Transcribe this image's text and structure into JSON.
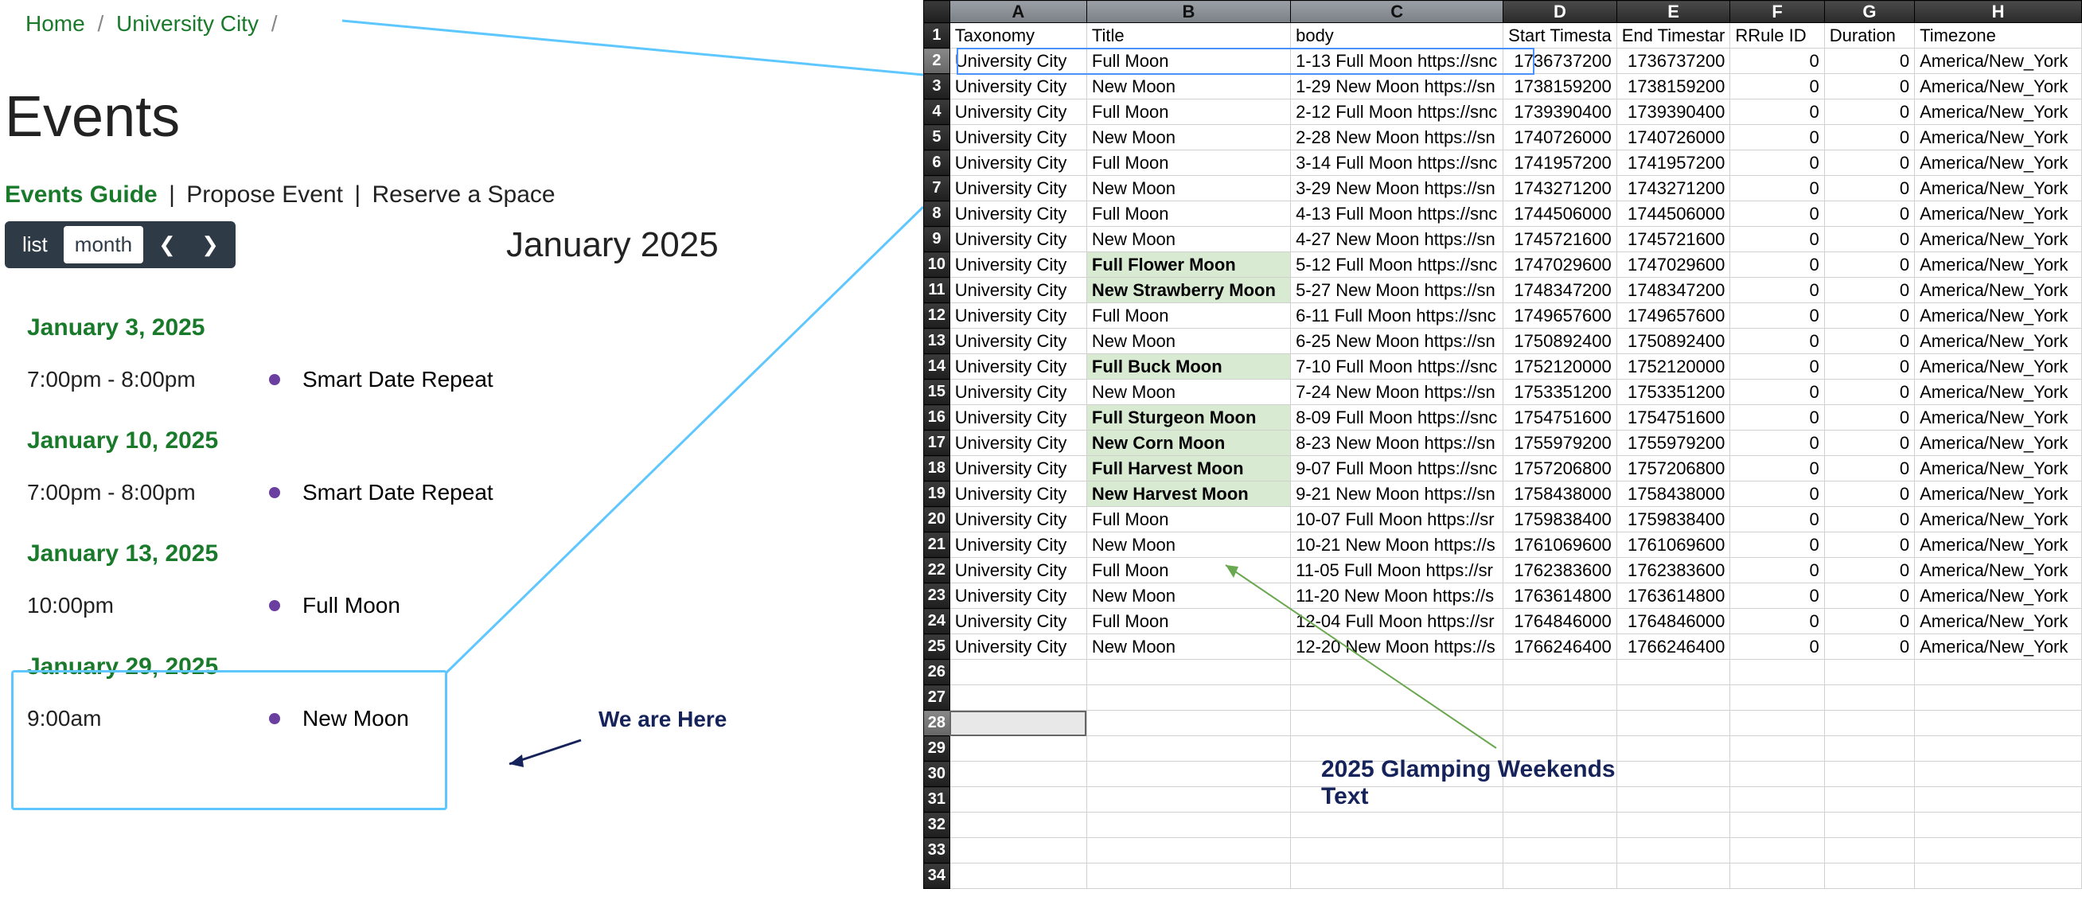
{
  "breadcrumb": {
    "home": "Home",
    "city": "University City"
  },
  "page_title": "Events",
  "subnav": {
    "guide": "Events Guide",
    "propose": "Propose Event",
    "reserve": "Reserve a Space"
  },
  "view": {
    "list": "list",
    "month": "month"
  },
  "month_label": "January 2025",
  "groups": [
    {
      "date": "January 3, 2025",
      "events": [
        {
          "time": "7:00pm - 8:00pm",
          "title": "Smart Date Repeat"
        }
      ]
    },
    {
      "date": "January 10, 2025",
      "events": [
        {
          "time": "7:00pm - 8:00pm",
          "title": "Smart Date Repeat"
        }
      ]
    },
    {
      "date": "January 13, 2025",
      "events": [
        {
          "time": "10:00pm",
          "title": "Full Moon"
        }
      ]
    },
    {
      "date": "January 29, 2025",
      "events": [
        {
          "time": "9:00am",
          "title": "New Moon"
        }
      ]
    }
  ],
  "callout": "We are Here",
  "sheet_annot": "2025 Glamping Weekends\nText",
  "columns": [
    "A",
    "B",
    "C",
    "D",
    "E",
    "F",
    "G",
    "H"
  ],
  "headers": [
    "Taxonomy",
    "Title",
    "body",
    "Start Timesta",
    "End Timestar",
    "RRule ID",
    "Duration",
    "Timezone"
  ],
  "rows": [
    {
      "a": "University City",
      "b": "Full Moon",
      "c": "1-13 Full Moon https://snc",
      "d": "1736737200",
      "e": "1736737200",
      "f": "0",
      "g": "0",
      "h": "America/New_York"
    },
    {
      "a": "University City",
      "b": "New Moon",
      "c": "1-29 New Moon https://sn",
      "d": "1738159200",
      "e": "1738159200",
      "f": "0",
      "g": "0",
      "h": "America/New_York"
    },
    {
      "a": "University City",
      "b": "Full Moon",
      "c": "2-12 Full Moon https://snc",
      "d": "1739390400",
      "e": "1739390400",
      "f": "0",
      "g": "0",
      "h": "America/New_York"
    },
    {
      "a": "University City",
      "b": "New Moon",
      "c": "2-28 New Moon https://sn",
      "d": "1740726000",
      "e": "1740726000",
      "f": "0",
      "g": "0",
      "h": "America/New_York"
    },
    {
      "a": "University City",
      "b": "Full Moon",
      "c": "3-14 Full Moon https://snc",
      "d": "1741957200",
      "e": "1741957200",
      "f": "0",
      "g": "0",
      "h": "America/New_York"
    },
    {
      "a": "University City",
      "b": "New Moon",
      "c": "3-29 New Moon https://sn",
      "d": "1743271200",
      "e": "1743271200",
      "f": "0",
      "g": "0",
      "h": "America/New_York"
    },
    {
      "a": "University City",
      "b": "Full Moon",
      "c": "4-13 Full Moon https://snc",
      "d": "1744506000",
      "e": "1744506000",
      "f": "0",
      "g": "0",
      "h": "America/New_York"
    },
    {
      "a": "University City",
      "b": "New Moon",
      "c": "4-27 New Moon https://sn",
      "d": "1745721600",
      "e": "1745721600",
      "f": "0",
      "g": "0",
      "h": "America/New_York"
    },
    {
      "a": "University City",
      "b": "Full Flower Moon",
      "bold": true,
      "hl": true,
      "c": "5-12 Full Moon https://snc",
      "d": "1747029600",
      "e": "1747029600",
      "f": "0",
      "g": "0",
      "h": "America/New_York"
    },
    {
      "a": "University City",
      "b": "New Strawberry Moon",
      "bold": true,
      "hl": true,
      "c": "5-27 New Moon https://sn",
      "d": "1748347200",
      "e": "1748347200",
      "f": "0",
      "g": "0",
      "h": "America/New_York"
    },
    {
      "a": "University City",
      "b": "Full Moon",
      "c": "6-11 Full Moon https://snc",
      "d": "1749657600",
      "e": "1749657600",
      "f": "0",
      "g": "0",
      "h": "America/New_York"
    },
    {
      "a": "University City",
      "b": "New Moon",
      "c": "6-25 New Moon https://sn",
      "d": "1750892400",
      "e": "1750892400",
      "f": "0",
      "g": "0",
      "h": "America/New_York"
    },
    {
      "a": "University City",
      "b": "Full Buck Moon",
      "bold": true,
      "hl": true,
      "c": "7-10 Full Moon https://snc",
      "d": "1752120000",
      "e": "1752120000",
      "f": "0",
      "g": "0",
      "h": "America/New_York"
    },
    {
      "a": "University City",
      "b": "New Moon",
      "c": "7-24 New Moon https://sn",
      "d": "1753351200",
      "e": "1753351200",
      "f": "0",
      "g": "0",
      "h": "America/New_York"
    },
    {
      "a": "University City",
      "b": "Full Sturgeon Moon",
      "bold": true,
      "hl": true,
      "c": "8-09 Full Moon https://snc",
      "d": "1754751600",
      "e": "1754751600",
      "f": "0",
      "g": "0",
      "h": "America/New_York"
    },
    {
      "a": "University City",
      "b": "New Corn Moon",
      "bold": true,
      "hl": true,
      "c": "8-23 New Moon https://sn",
      "d": "1755979200",
      "e": "1755979200",
      "f": "0",
      "g": "0",
      "h": "America/New_York"
    },
    {
      "a": "University City",
      "b": "Full Harvest Moon",
      "bold": true,
      "hl": true,
      "c": "9-07 Full Moon https://snc",
      "d": "1757206800",
      "e": "1757206800",
      "f": "0",
      "g": "0",
      "h": "America/New_York"
    },
    {
      "a": "University City",
      "b": "New Harvest Moon",
      "bold": true,
      "hl": true,
      "c": "9-21 New Moon https://sn",
      "d": "1758438000",
      "e": "1758438000",
      "f": "0",
      "g": "0",
      "h": "America/New_York"
    },
    {
      "a": "University City",
      "b": "Full Moon",
      "c": "10-07 Full Moon https://sr",
      "d": "1759838400",
      "e": "1759838400",
      "f": "0",
      "g": "0",
      "h": "America/New_York"
    },
    {
      "a": "University City",
      "b": "New Moon",
      "c": "10-21 New Moon https://s",
      "d": "1761069600",
      "e": "1761069600",
      "f": "0",
      "g": "0",
      "h": "America/New_York"
    },
    {
      "a": "University City",
      "b": "Full Moon",
      "c": "11-05 Full Moon https://sr",
      "d": "1762383600",
      "e": "1762383600",
      "f": "0",
      "g": "0",
      "h": "America/New_York"
    },
    {
      "a": "University City",
      "b": "New Moon",
      "c": "11-20 New Moon https://s",
      "d": "1763614800",
      "e": "1763614800",
      "f": "0",
      "g": "0",
      "h": "America/New_York"
    },
    {
      "a": "University City",
      "b": "Full Moon",
      "c": "12-04 Full Moon https://sr",
      "d": "1764846000",
      "e": "1764846000",
      "f": "0",
      "g": "0",
      "h": "America/New_York"
    },
    {
      "a": "University City",
      "b": "New Moon",
      "c": "12-20 New Moon https://s",
      "d": "1766246400",
      "e": "1766246400",
      "f": "0",
      "g": "0",
      "h": "America/New_York"
    }
  ],
  "empty_rows": 9
}
